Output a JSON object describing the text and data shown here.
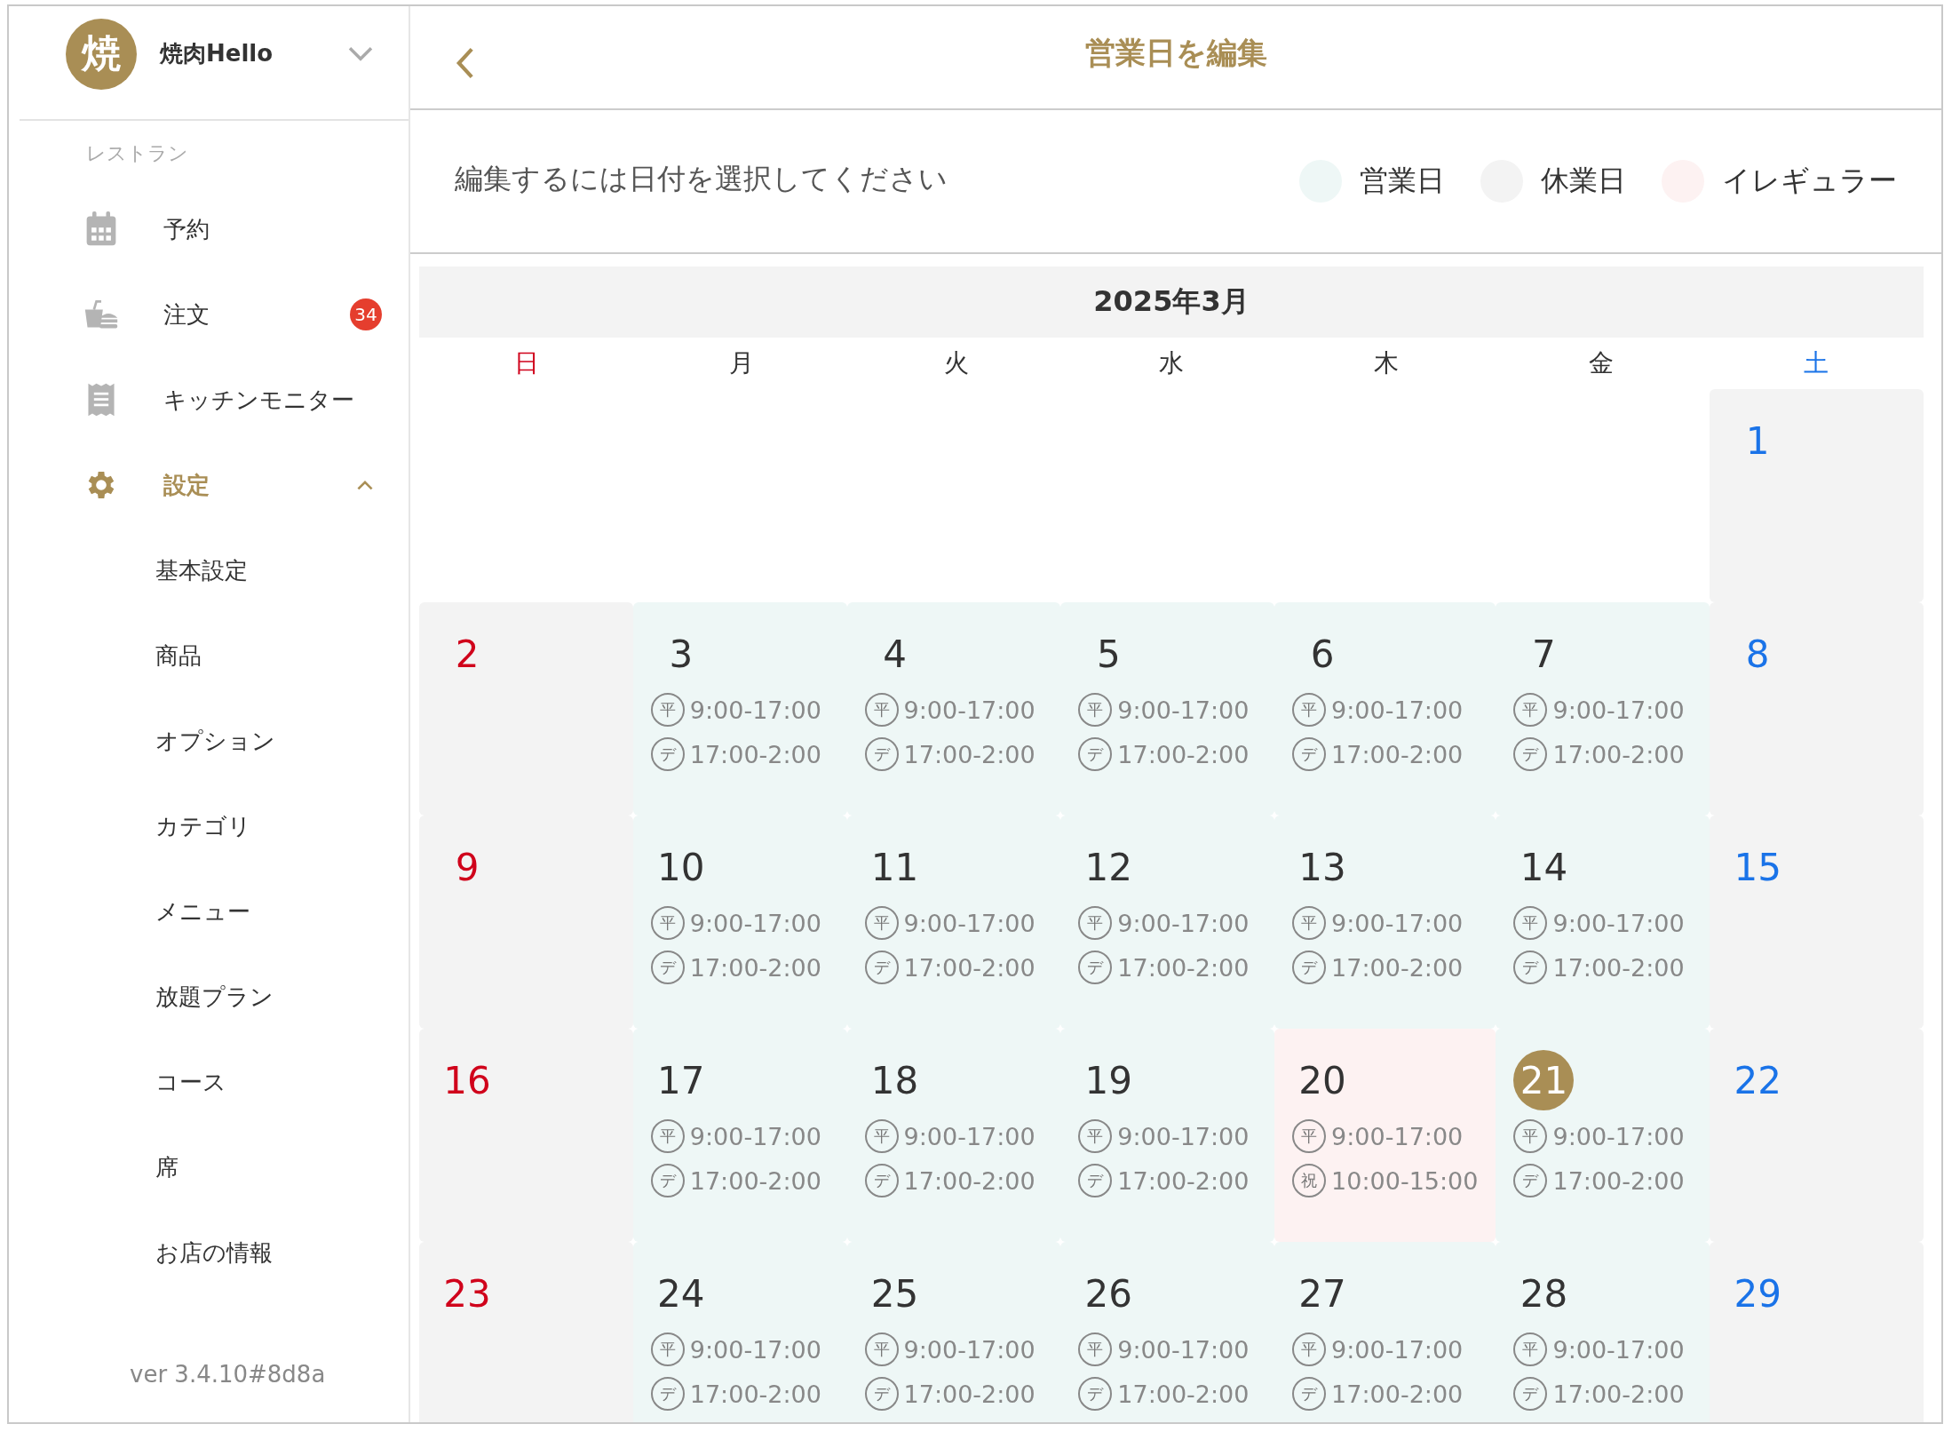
{
  "sidebar": {
    "avatar": "焼",
    "shop_name": "焼肉Hello",
    "section_label": "レストラン",
    "items": [
      {
        "label": "予約",
        "kind": "calendar",
        "selected": false
      },
      {
        "label": "注文",
        "kind": "food",
        "badge": "34",
        "selected": false
      },
      {
        "label": "キッチンモニター",
        "kind": "receipt",
        "selected": false
      },
      {
        "label": "設定",
        "kind": "gear",
        "selected": true,
        "expanded": true,
        "children": [
          {
            "label": "基本設定"
          },
          {
            "label": "商品"
          },
          {
            "label": "オプション"
          },
          {
            "label": "カテゴリ"
          },
          {
            "label": "メニュー"
          },
          {
            "label": "放題プラン"
          },
          {
            "label": "コース"
          },
          {
            "label": "席"
          },
          {
            "label": "お店の情報"
          }
        ]
      }
    ],
    "version": "ver 3.4.10#8d8a"
  },
  "header": {
    "title": "営業日を編集"
  },
  "instruction": "編集するには日付を選択してください",
  "legend": [
    {
      "label": "営業日",
      "kind": "business",
      "color": "#eef7f6"
    },
    {
      "label": "休業日",
      "kind": "closed",
      "color": "#f3f3f3"
    },
    {
      "label": "イレギュラー",
      "kind": "irregular",
      "color": "#fdf2f2"
    }
  ],
  "calendar": {
    "month": "2025年3月",
    "weekdays": [
      "日",
      "月",
      "火",
      "水",
      "木",
      "金",
      "土"
    ],
    "weeks": [
      [
        {
          "kind": "blank"
        },
        {
          "kind": "blank"
        },
        {
          "kind": "blank"
        },
        {
          "kind": "blank"
        },
        {
          "kind": "blank"
        },
        {
          "kind": "blank"
        },
        {
          "day": "1",
          "kind": "closed",
          "selected": false
        }
      ],
      [
        {
          "day": "2",
          "kind": "closed",
          "selected": false
        },
        {
          "day": "3",
          "kind": "business",
          "selected": false,
          "hours": [
            {
              "tag": "平",
              "time": "9:00-17:00"
            },
            {
              "tag": "デ",
              "time": "17:00-2:00"
            }
          ]
        },
        {
          "day": "4",
          "kind": "business",
          "selected": false,
          "hours": [
            {
              "tag": "平",
              "time": "9:00-17:00"
            },
            {
              "tag": "デ",
              "time": "17:00-2:00"
            }
          ]
        },
        {
          "day": "5",
          "kind": "business",
          "selected": false,
          "hours": [
            {
              "tag": "平",
              "time": "9:00-17:00"
            },
            {
              "tag": "デ",
              "time": "17:00-2:00"
            }
          ]
        },
        {
          "day": "6",
          "kind": "business",
          "selected": false,
          "hours": [
            {
              "tag": "平",
              "time": "9:00-17:00"
            },
            {
              "tag": "デ",
              "time": "17:00-2:00"
            }
          ]
        },
        {
          "day": "7",
          "kind": "business",
          "selected": false,
          "hours": [
            {
              "tag": "平",
              "time": "9:00-17:00"
            },
            {
              "tag": "デ",
              "time": "17:00-2:00"
            }
          ]
        },
        {
          "day": "8",
          "kind": "closed",
          "selected": false
        }
      ],
      [
        {
          "day": "9",
          "kind": "closed",
          "selected": false
        },
        {
          "day": "10",
          "kind": "business",
          "selected": false,
          "hours": [
            {
              "tag": "平",
              "time": "9:00-17:00"
            },
            {
              "tag": "デ",
              "time": "17:00-2:00"
            }
          ]
        },
        {
          "day": "11",
          "kind": "business",
          "selected": false,
          "hours": [
            {
              "tag": "平",
              "time": "9:00-17:00"
            },
            {
              "tag": "デ",
              "time": "17:00-2:00"
            }
          ]
        },
        {
          "day": "12",
          "kind": "business",
          "selected": false,
          "hours": [
            {
              "tag": "平",
              "time": "9:00-17:00"
            },
            {
              "tag": "デ",
              "time": "17:00-2:00"
            }
          ]
        },
        {
          "day": "13",
          "kind": "business",
          "selected": false,
          "hours": [
            {
              "tag": "平",
              "time": "9:00-17:00"
            },
            {
              "tag": "デ",
              "time": "17:00-2:00"
            }
          ]
        },
        {
          "day": "14",
          "kind": "business",
          "selected": false,
          "hours": [
            {
              "tag": "平",
              "time": "9:00-17:00"
            },
            {
              "tag": "デ",
              "time": "17:00-2:00"
            }
          ]
        },
        {
          "day": "15",
          "kind": "closed",
          "selected": false
        }
      ],
      [
        {
          "day": "16",
          "kind": "closed",
          "selected": false
        },
        {
          "day": "17",
          "kind": "business",
          "selected": false,
          "hours": [
            {
              "tag": "平",
              "time": "9:00-17:00"
            },
            {
              "tag": "デ",
              "time": "17:00-2:00"
            }
          ]
        },
        {
          "day": "18",
          "kind": "business",
          "selected": false,
          "hours": [
            {
              "tag": "平",
              "time": "9:00-17:00"
            },
            {
              "tag": "デ",
              "time": "17:00-2:00"
            }
          ]
        },
        {
          "day": "19",
          "kind": "business",
          "selected": false,
          "hours": [
            {
              "tag": "平",
              "time": "9:00-17:00"
            },
            {
              "tag": "デ",
              "time": "17:00-2:00"
            }
          ]
        },
        {
          "day": "20",
          "kind": "irregular",
          "selected": false,
          "hours": [
            {
              "tag": "平",
              "time": "9:00-17:00"
            },
            {
              "tag": "祝",
              "time": "10:00-15:00"
            }
          ]
        },
        {
          "day": "21",
          "kind": "business",
          "selected": true,
          "hours": [
            {
              "tag": "平",
              "time": "9:00-17:00"
            },
            {
              "tag": "デ",
              "time": "17:00-2:00"
            }
          ]
        },
        {
          "day": "22",
          "kind": "closed",
          "selected": false
        }
      ],
      [
        {
          "day": "23",
          "kind": "closed",
          "selected": false
        },
        {
          "day": "24",
          "kind": "business",
          "selected": false,
          "hours": [
            {
              "tag": "平",
              "time": "9:00-17:00"
            },
            {
              "tag": "デ",
              "time": "17:00-2:00"
            }
          ]
        },
        {
          "day": "25",
          "kind": "business",
          "selected": false,
          "hours": [
            {
              "tag": "平",
              "time": "9:00-17:00"
            },
            {
              "tag": "デ",
              "time": "17:00-2:00"
            }
          ]
        },
        {
          "day": "26",
          "kind": "business",
          "selected": false,
          "hours": [
            {
              "tag": "平",
              "time": "9:00-17:00"
            },
            {
              "tag": "デ",
              "time": "17:00-2:00"
            }
          ]
        },
        {
          "day": "27",
          "kind": "business",
          "selected": false,
          "hours": [
            {
              "tag": "平",
              "time": "9:00-17:00"
            },
            {
              "tag": "デ",
              "time": "17:00-2:00"
            }
          ]
        },
        {
          "day": "28",
          "kind": "business",
          "selected": false,
          "hours": [
            {
              "tag": "平",
              "time": "9:00-17:00"
            },
            {
              "tag": "デ",
              "time": "17:00-2:00"
            }
          ]
        },
        {
          "day": "29",
          "kind": "closed",
          "selected": false
        }
      ]
    ]
  }
}
